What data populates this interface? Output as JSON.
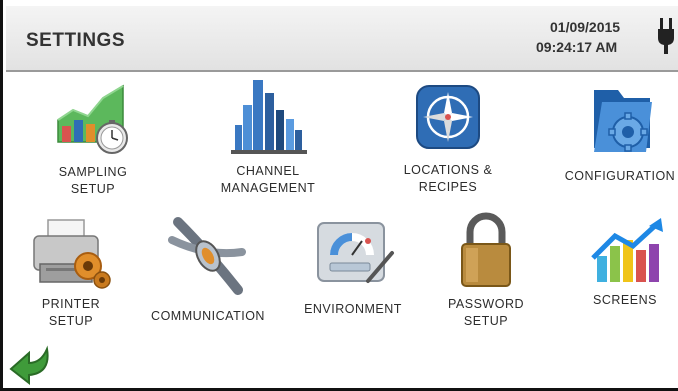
{
  "header": {
    "title": "SETTINGS",
    "date": "01/09/2015",
    "time": "09:24:17 AM",
    "power_icon": "plug-icon"
  },
  "tiles": [
    {
      "label": "SAMPLING\nSETUP",
      "icon": "sampling-chart-clock-icon"
    },
    {
      "label": "CHANNEL\nMANAGEMENT",
      "icon": "channel-bar-chart-icon"
    },
    {
      "label": "LOCATIONS &\nRECIPES",
      "icon": "compass-icon"
    },
    {
      "label": "CONFIGURATION",
      "icon": "folder-gear-icon"
    },
    {
      "label": "PRINTER\nSETUP",
      "icon": "printer-gear-icon"
    },
    {
      "label": "COMMUNICATION",
      "icon": "cable-icon"
    },
    {
      "label": "ENVIRONMENT",
      "icon": "gauge-panel-icon"
    },
    {
      "label": "PASSWORD\nSETUP",
      "icon": "padlock-icon"
    },
    {
      "label": "SCREENS",
      "icon": "colored-bars-arrow-icon"
    }
  ],
  "footer": {
    "back_icon": "back-arrow-icon"
  },
  "colors": {
    "header_bg": "#e8e8e8",
    "text": "#333333",
    "accent_blue": "#2f6db5",
    "back_green": "#3f9b3a"
  }
}
